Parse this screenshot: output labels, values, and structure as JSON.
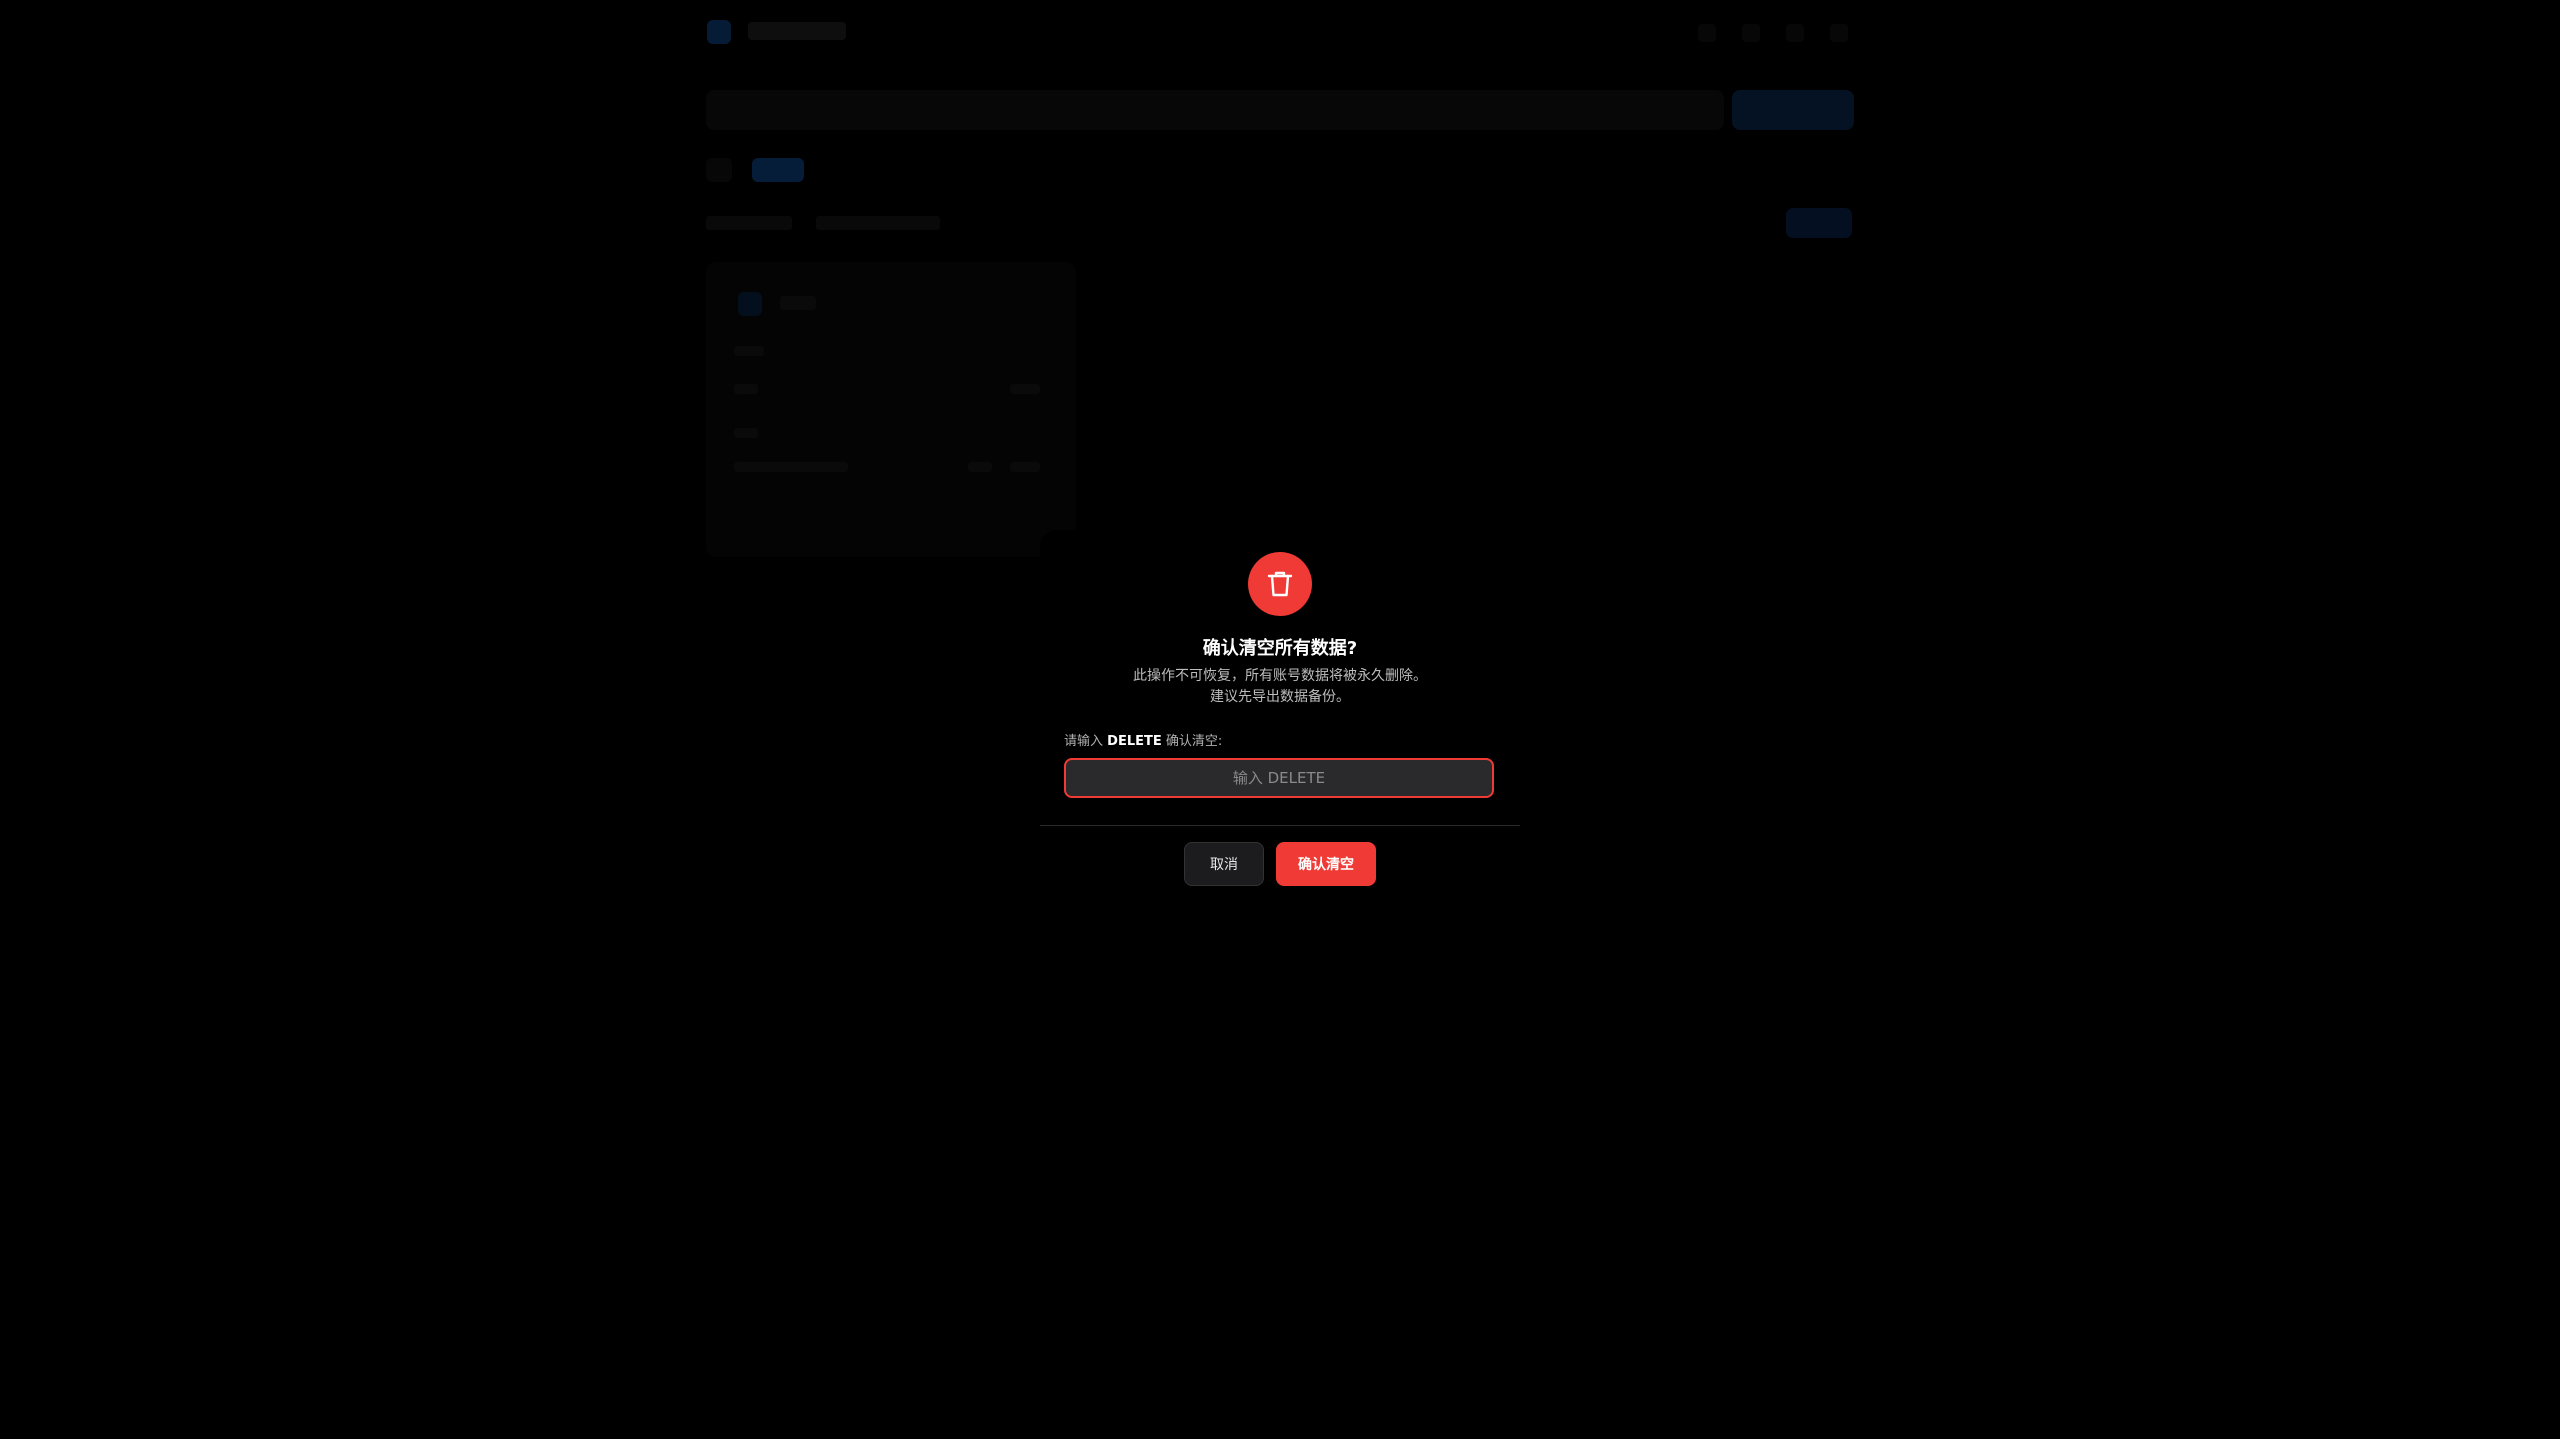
{
  "modal": {
    "icon": "trash-icon",
    "title": "确认清空所有数据?",
    "description": [
      "此操作不可恢复，所有账号数据将被永久删除。",
      "建议先导出数据备份。"
    ],
    "input_label_prefix": "请输入",
    "input_label_keyword": "DELETE",
    "input_label_suffix": "确认清空:",
    "input_placeholder": "输入 DELETE",
    "input_value": "",
    "cancel_label": "取消",
    "confirm_label": "确认清空"
  },
  "colors": {
    "danger": "#f03a35",
    "background": "#000000",
    "input_bg": "#2a2a2c"
  }
}
